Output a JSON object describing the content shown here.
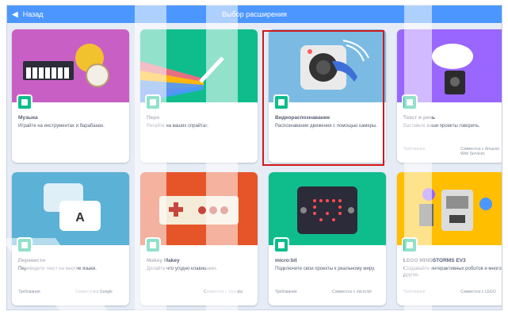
{
  "header": {
    "back_label": "Назад",
    "title": "Выбор расширения",
    "color": "#4c97ff"
  },
  "highlight_color": "#d0191b",
  "extensions": [
    {
      "name": "Музыка",
      "description": "Играйте на инструментах и барабанах.",
      "icon": "music-icon",
      "req_left": "",
      "req_right": ""
    },
    {
      "name": "Перо",
      "description": "Рисуйте на ваших спрайтах.",
      "icon": "pen-icon",
      "req_left": "",
      "req_right": ""
    },
    {
      "name": "Видеораспознавание",
      "description": "Распознавание движения с помощью камеры.",
      "icon": "video-sensing-icon",
      "req_left": "",
      "req_right": ""
    },
    {
      "name": "Текст в речь",
      "description": "Заставьте ваши проекты говорить.",
      "icon": "text-to-speech-icon",
      "req_left": "Требования",
      "req_right": "Совместно с Amazon Web Services"
    },
    {
      "name": "Перевести",
      "description": "Переведите текст на многие языки.",
      "icon": "translate-icon",
      "req_left": "Требования",
      "req_right": "Совместно с Google"
    },
    {
      "name": "Makey Makey",
      "description": "Делайте что угодно клавишами.",
      "icon": "makey-makey-icon",
      "req_left": "",
      "req_right": "Совместно с JoyLabz"
    },
    {
      "name": "micro:bit",
      "description": "Подключите свои проекты к реальному миру.",
      "icon": "microbit-icon",
      "req_left": "Требования",
      "req_right": "Совместно с micro:bit"
    },
    {
      "name": "LEGO MINDSTORMS EV3",
      "description": "Создавайте интерактивных роботов и многое другое.",
      "icon": "lego-ev3-icon",
      "req_left": "Требования",
      "req_right": "Совместно с LEGO"
    }
  ]
}
